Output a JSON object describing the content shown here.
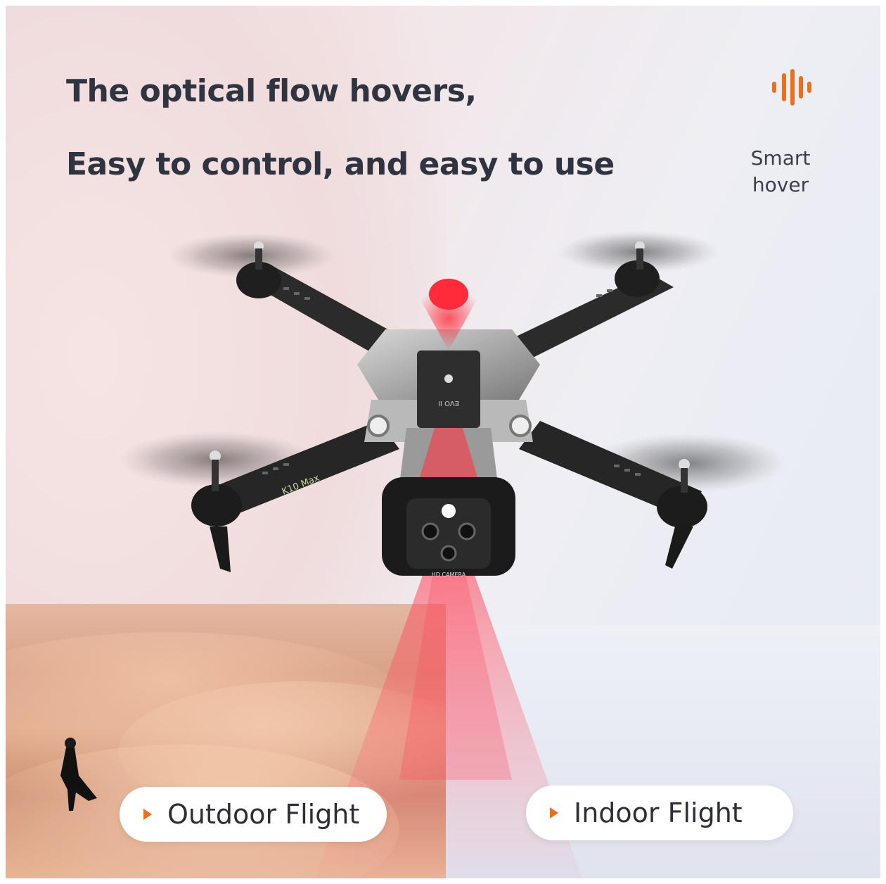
{
  "headline": {
    "line1": "The optical flow hovers,",
    "line2": "Easy to control, and easy to use"
  },
  "feature": {
    "icon": "sound-wave-icon",
    "label": "Smart hover",
    "accent_color": "#e8701f"
  },
  "drone": {
    "arm_label": "K10 Max",
    "top_label": "EVO II",
    "camera_label": "HD CAMERA"
  },
  "scenes": [
    {
      "label": "Outdoor Flight",
      "icon": "play-arrow-icon"
    },
    {
      "label": "Indoor Flight",
      "icon": "play-arrow-icon"
    }
  ]
}
